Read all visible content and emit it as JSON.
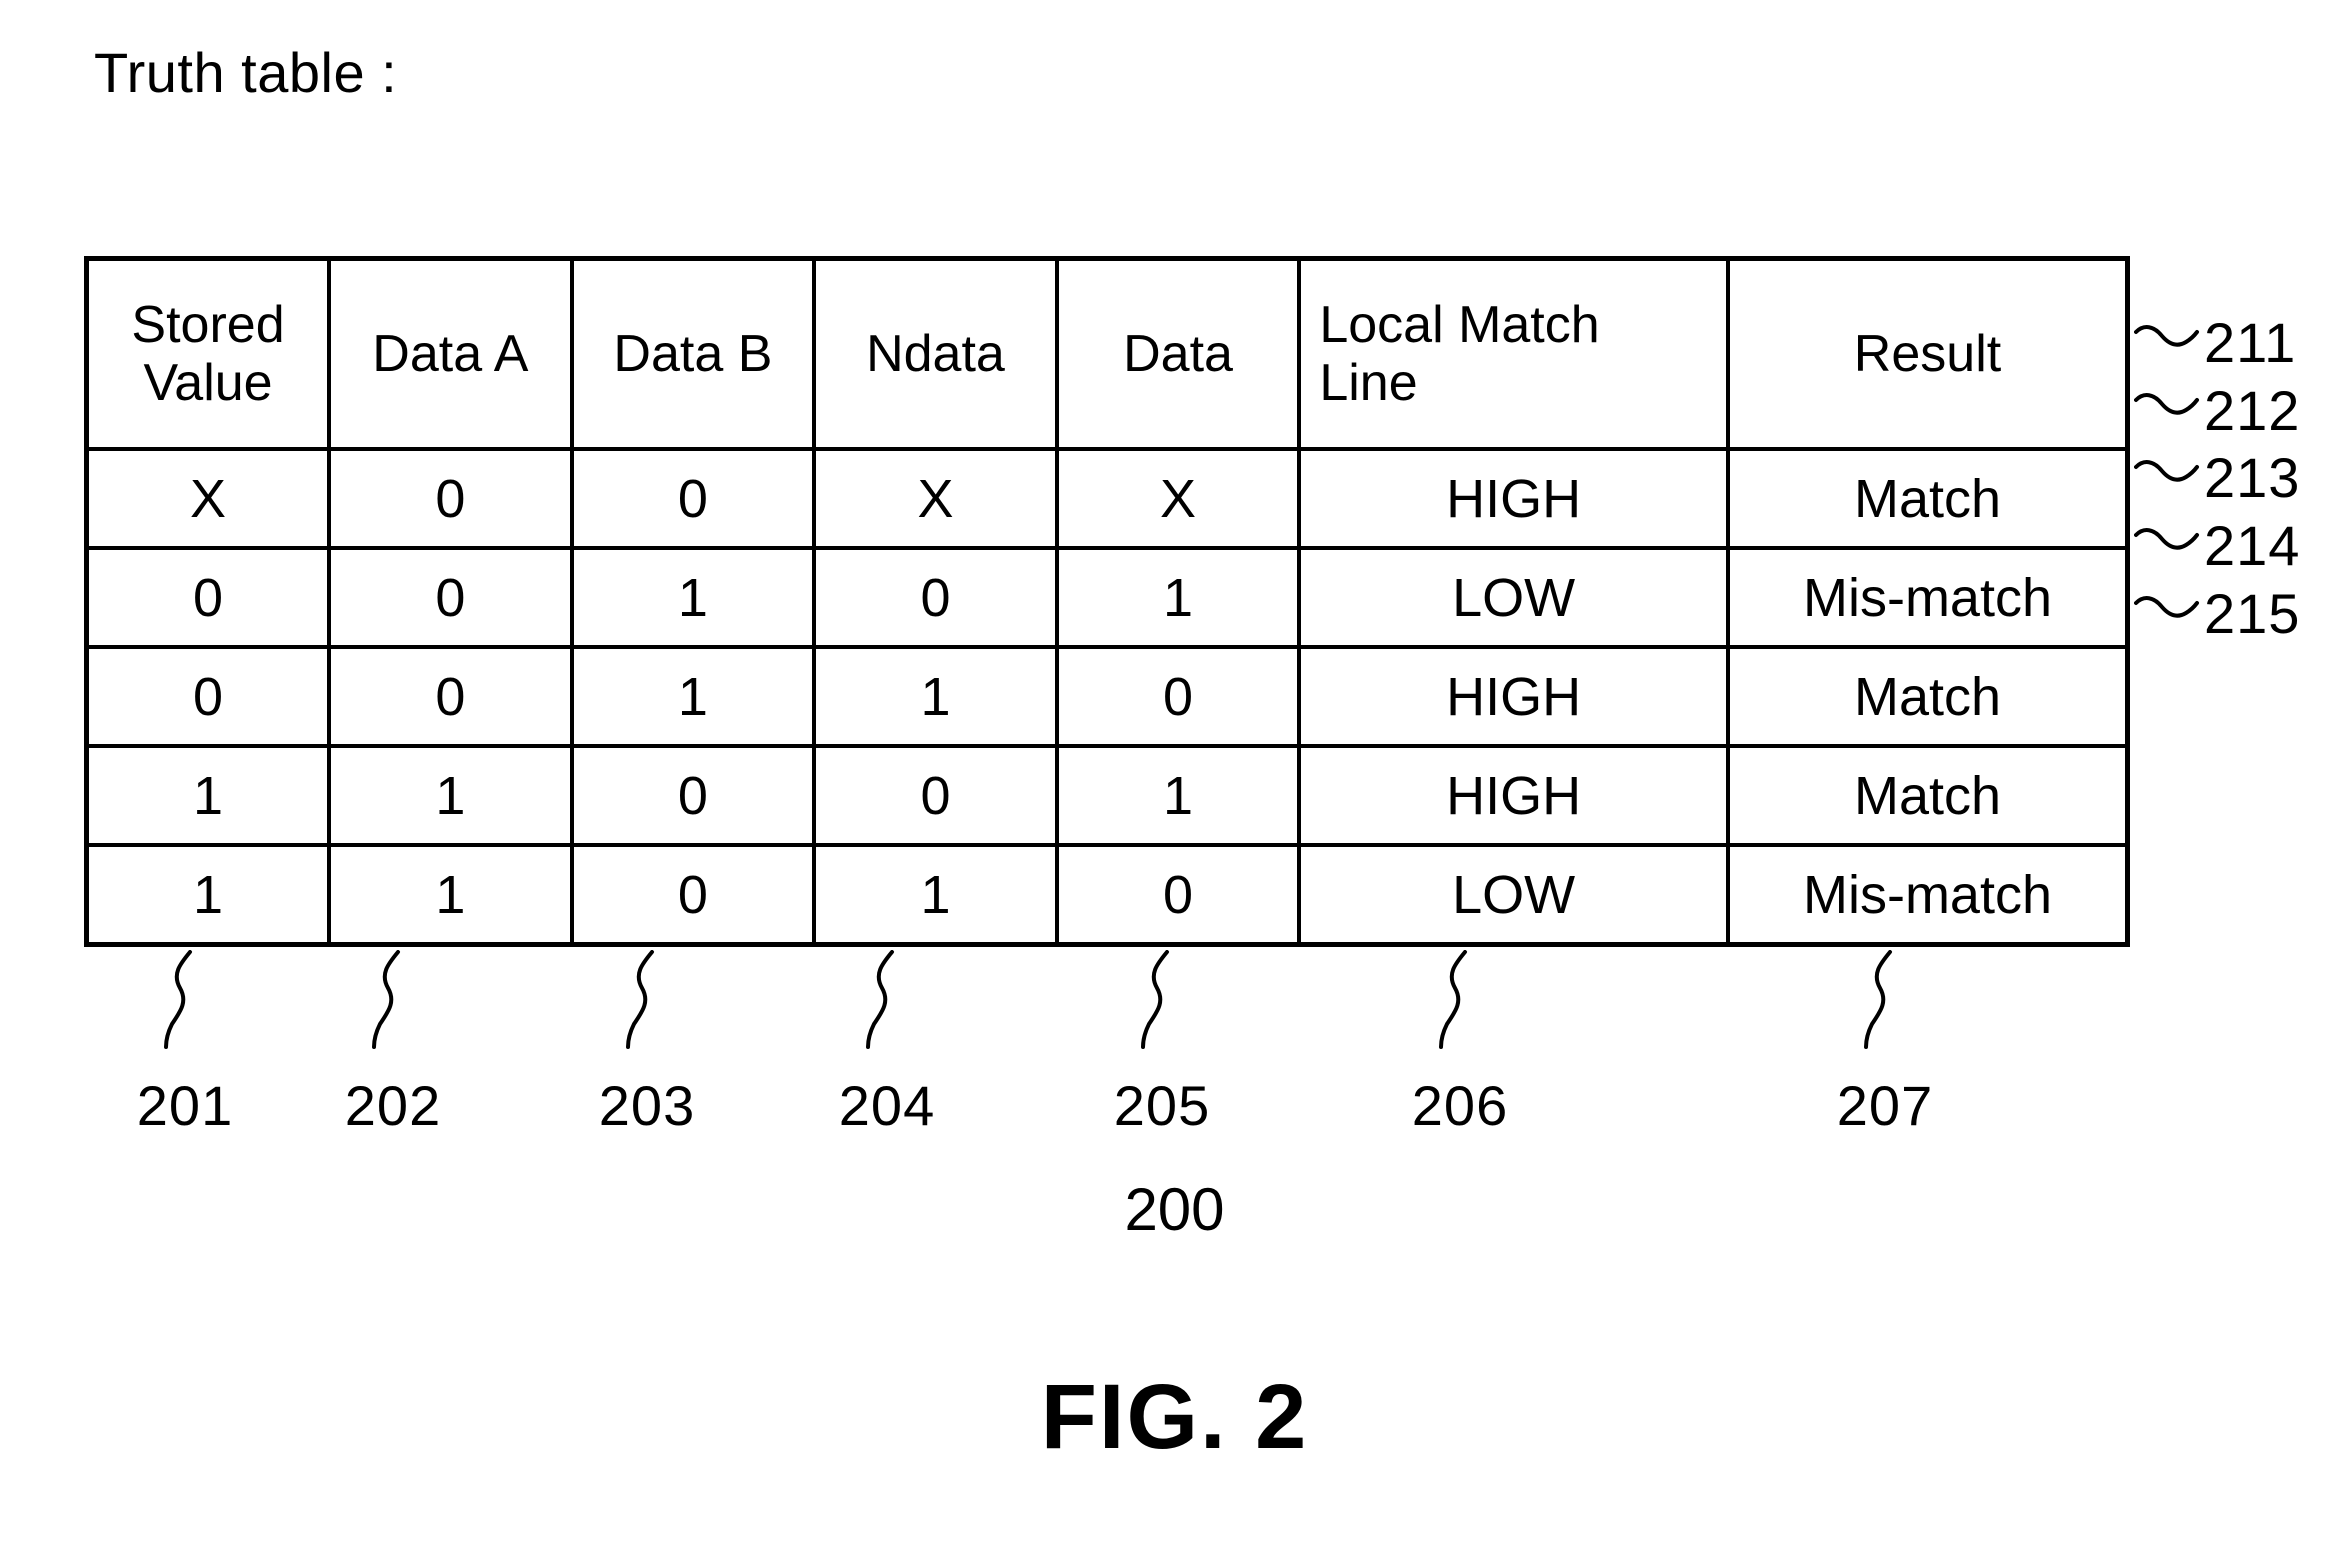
{
  "figure": {
    "title": "Truth table :",
    "caption": "FIG. 2",
    "diagram_number": "200"
  },
  "table": {
    "headers": [
      "Stored Value",
      "Data A",
      "Data B",
      "Ndata",
      "Data",
      "Local Match Line",
      "Result"
    ],
    "header_lines": {
      "stored_value": [
        "Stored",
        "Value"
      ],
      "local_match_line": [
        "Local Match",
        "Line"
      ]
    },
    "rows": [
      {
        "stored_value": "X",
        "data_a": "0",
        "data_b": "0",
        "ndata": "X",
        "data": "X",
        "local_match_line": "HIGH",
        "result": "Match"
      },
      {
        "stored_value": "0",
        "data_a": "0",
        "data_b": "1",
        "ndata": "0",
        "data": "1",
        "local_match_line": "LOW",
        "result": "Mis-match"
      },
      {
        "stored_value": "0",
        "data_a": "0",
        "data_b": "1",
        "ndata": "1",
        "data": "0",
        "local_match_line": "HIGH",
        "result": "Match"
      },
      {
        "stored_value": "1",
        "data_a": "1",
        "data_b": "0",
        "ndata": "0",
        "data": "1",
        "local_match_line": "HIGH",
        "result": "Match"
      },
      {
        "stored_value": "1",
        "data_a": "1",
        "data_b": "0",
        "ndata": "1",
        "data": "0",
        "local_match_line": "LOW",
        "result": "Mis-match"
      }
    ]
  },
  "reference_numerals": {
    "rows": [
      "211",
      "212",
      "213",
      "214",
      "215"
    ],
    "columns": [
      "201",
      "202",
      "203",
      "204",
      "205",
      "206",
      "207"
    ]
  }
}
